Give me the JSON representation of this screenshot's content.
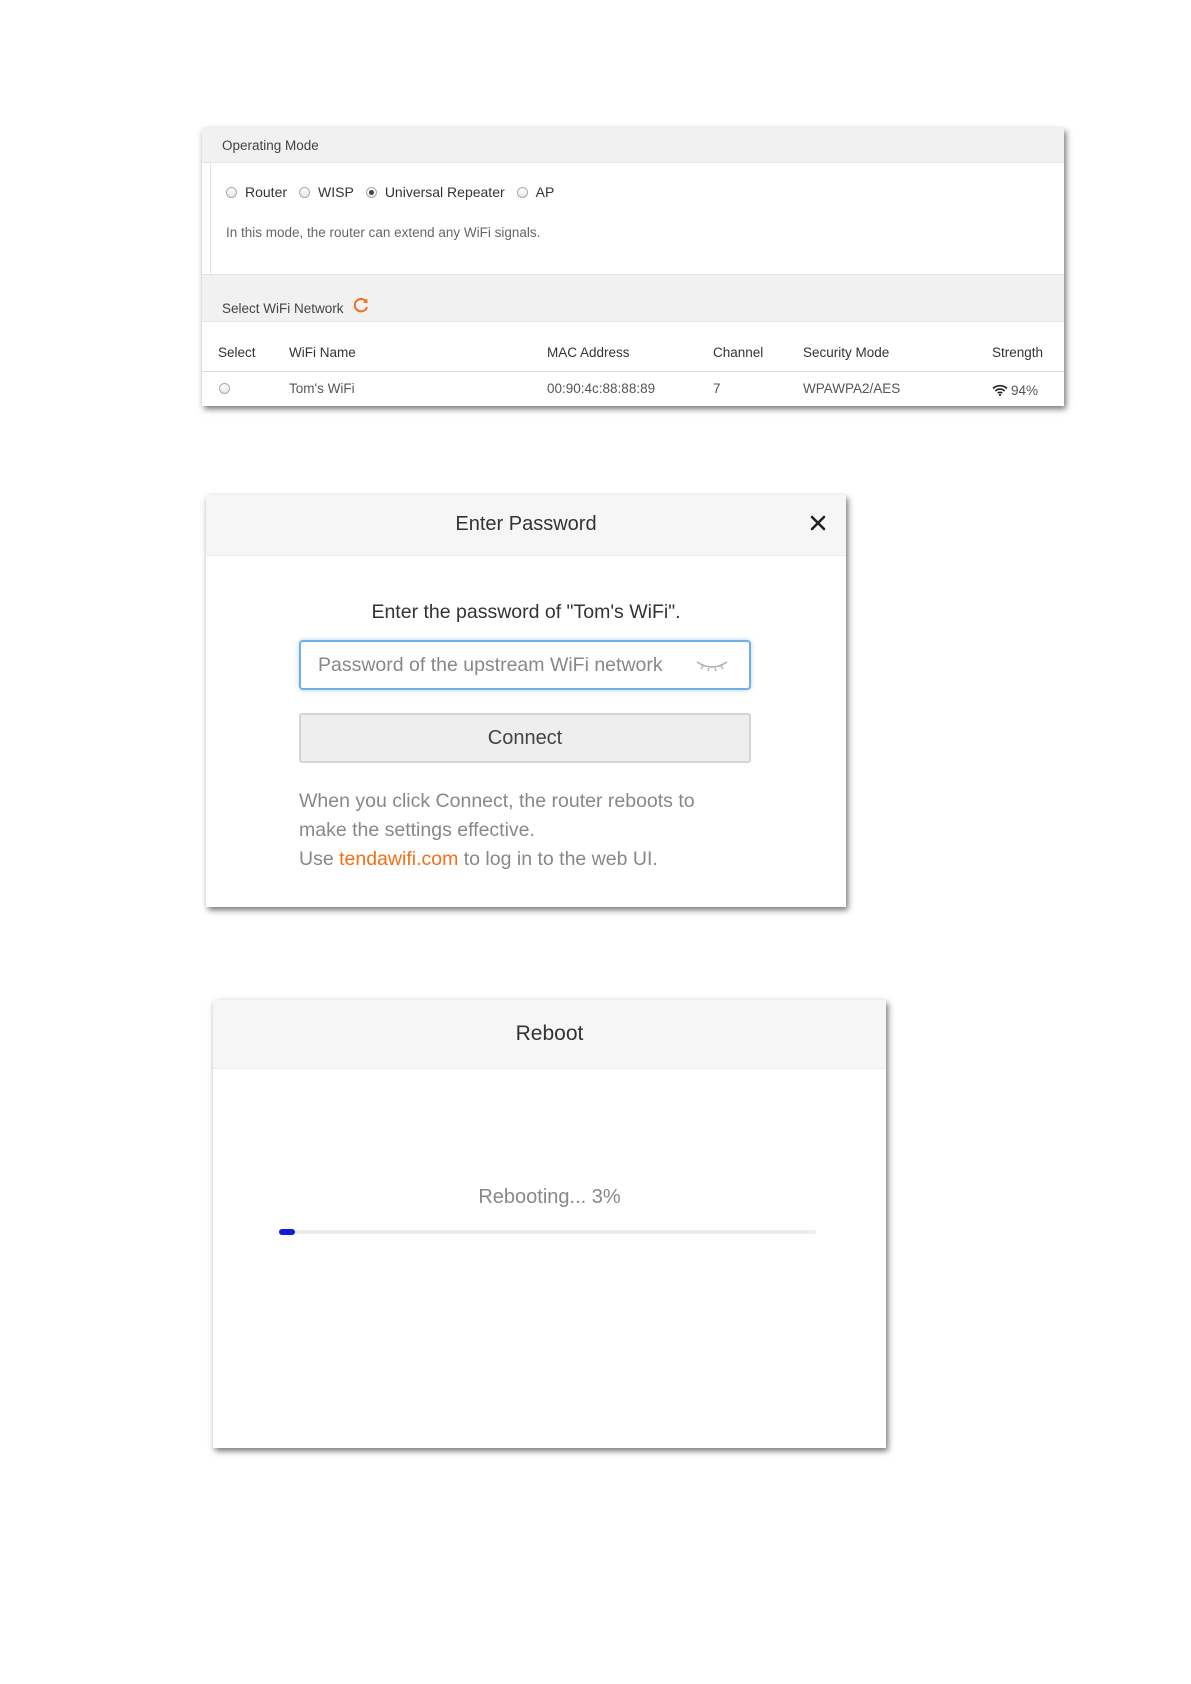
{
  "operating_mode": {
    "title": "Operating Mode",
    "modes": [
      {
        "label": "Router",
        "selected": false
      },
      {
        "label": "WISP",
        "selected": false
      },
      {
        "label": "Universal Repeater",
        "selected": true
      },
      {
        "label": "AP",
        "selected": false
      }
    ],
    "description": "In this mode, the router can extend any WiFi signals."
  },
  "wifi_network": {
    "title": "Select WiFi Network",
    "refresh_icon": "refresh-icon",
    "refresh_color": "#f56e16",
    "columns": [
      "Select",
      "WiFi Name",
      "MAC Address",
      "Channel",
      "Security Mode",
      "Strength"
    ],
    "rows": [
      {
        "name": "Tom's WiFi",
        "mac": "00:90:4c:88:88:89",
        "channel": "7",
        "security": "WPAWPA2/AES",
        "strength": "94%"
      }
    ]
  },
  "password_dialog": {
    "title": "Enter Password",
    "prompt": "Enter the password of \"Tom's WiFi\".",
    "input_placeholder": "Password of the upstream WiFi network",
    "connect_label": "Connect",
    "note_line1": "When you click Connect, the router reboots to",
    "note_line2": "make the settings effective.",
    "note_use": "Use",
    "note_link": "tendawifi.com",
    "note_tail": "to log in to the web UI.",
    "link_color": "#f56e16"
  },
  "reboot_dialog": {
    "title": "Reboot",
    "status": "Rebooting... 3%",
    "progress_percent": 3,
    "progress_color": "#1a1adc"
  }
}
